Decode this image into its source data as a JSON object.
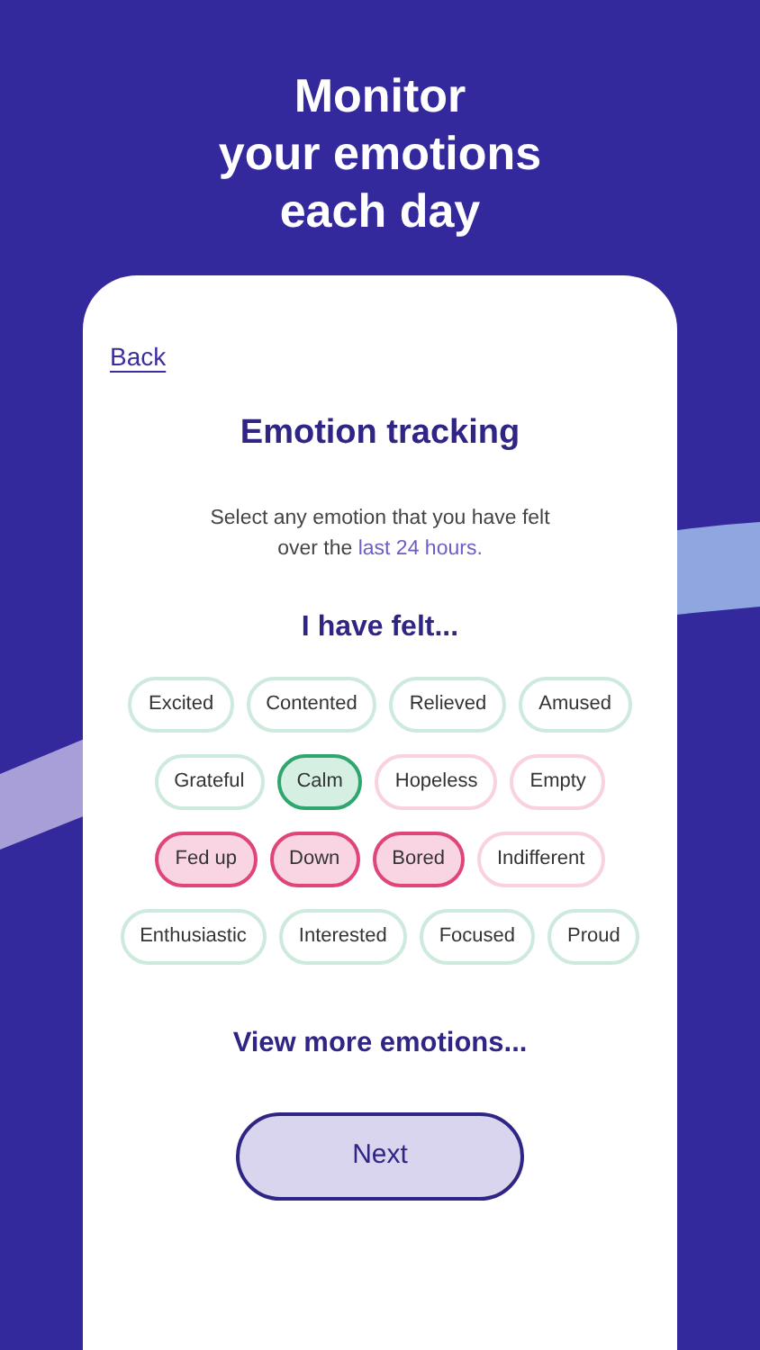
{
  "headline": [
    "Monitor",
    "your emotions",
    "each day"
  ],
  "card": {
    "back_link": "Back",
    "title": "Emotion tracking",
    "instruction": {
      "text": "Select any emotion that you have felt over the",
      "highlight": "last 24 hours."
    },
    "prompt": "I have felt...",
    "emotion_rows": [
      [
        {
          "label": "Excited",
          "kind": "positive",
          "selected": false
        },
        {
          "label": "Contented",
          "kind": "positive",
          "selected": false
        },
        {
          "label": "Relieved",
          "kind": "positive",
          "selected": false
        },
        {
          "label": "Amused",
          "kind": "positive",
          "selected": false
        }
      ],
      [
        {
          "label": "Grateful",
          "kind": "positive",
          "selected": false
        },
        {
          "label": "Calm",
          "kind": "positive",
          "selected": true
        },
        {
          "label": "Hopeless",
          "kind": "negative",
          "selected": false
        },
        {
          "label": "Empty",
          "kind": "negative",
          "selected": false
        }
      ],
      [
        {
          "label": "Fed up",
          "kind": "negative",
          "selected": true
        },
        {
          "label": "Down",
          "kind": "negative",
          "selected": true
        },
        {
          "label": "Bored",
          "kind": "negative",
          "selected": true
        },
        {
          "label": "Indifferent",
          "kind": "negative",
          "selected": false
        }
      ],
      [
        {
          "label": "Enthusiastic",
          "kind": "positive",
          "selected": false
        },
        {
          "label": "Interested",
          "kind": "positive",
          "selected": false
        },
        {
          "label": "Focused",
          "kind": "positive",
          "selected": false
        },
        {
          "label": "Proud",
          "kind": "positive",
          "selected": false
        }
      ]
    ],
    "view_more": "View more emotions...",
    "next_button": "Next"
  }
}
